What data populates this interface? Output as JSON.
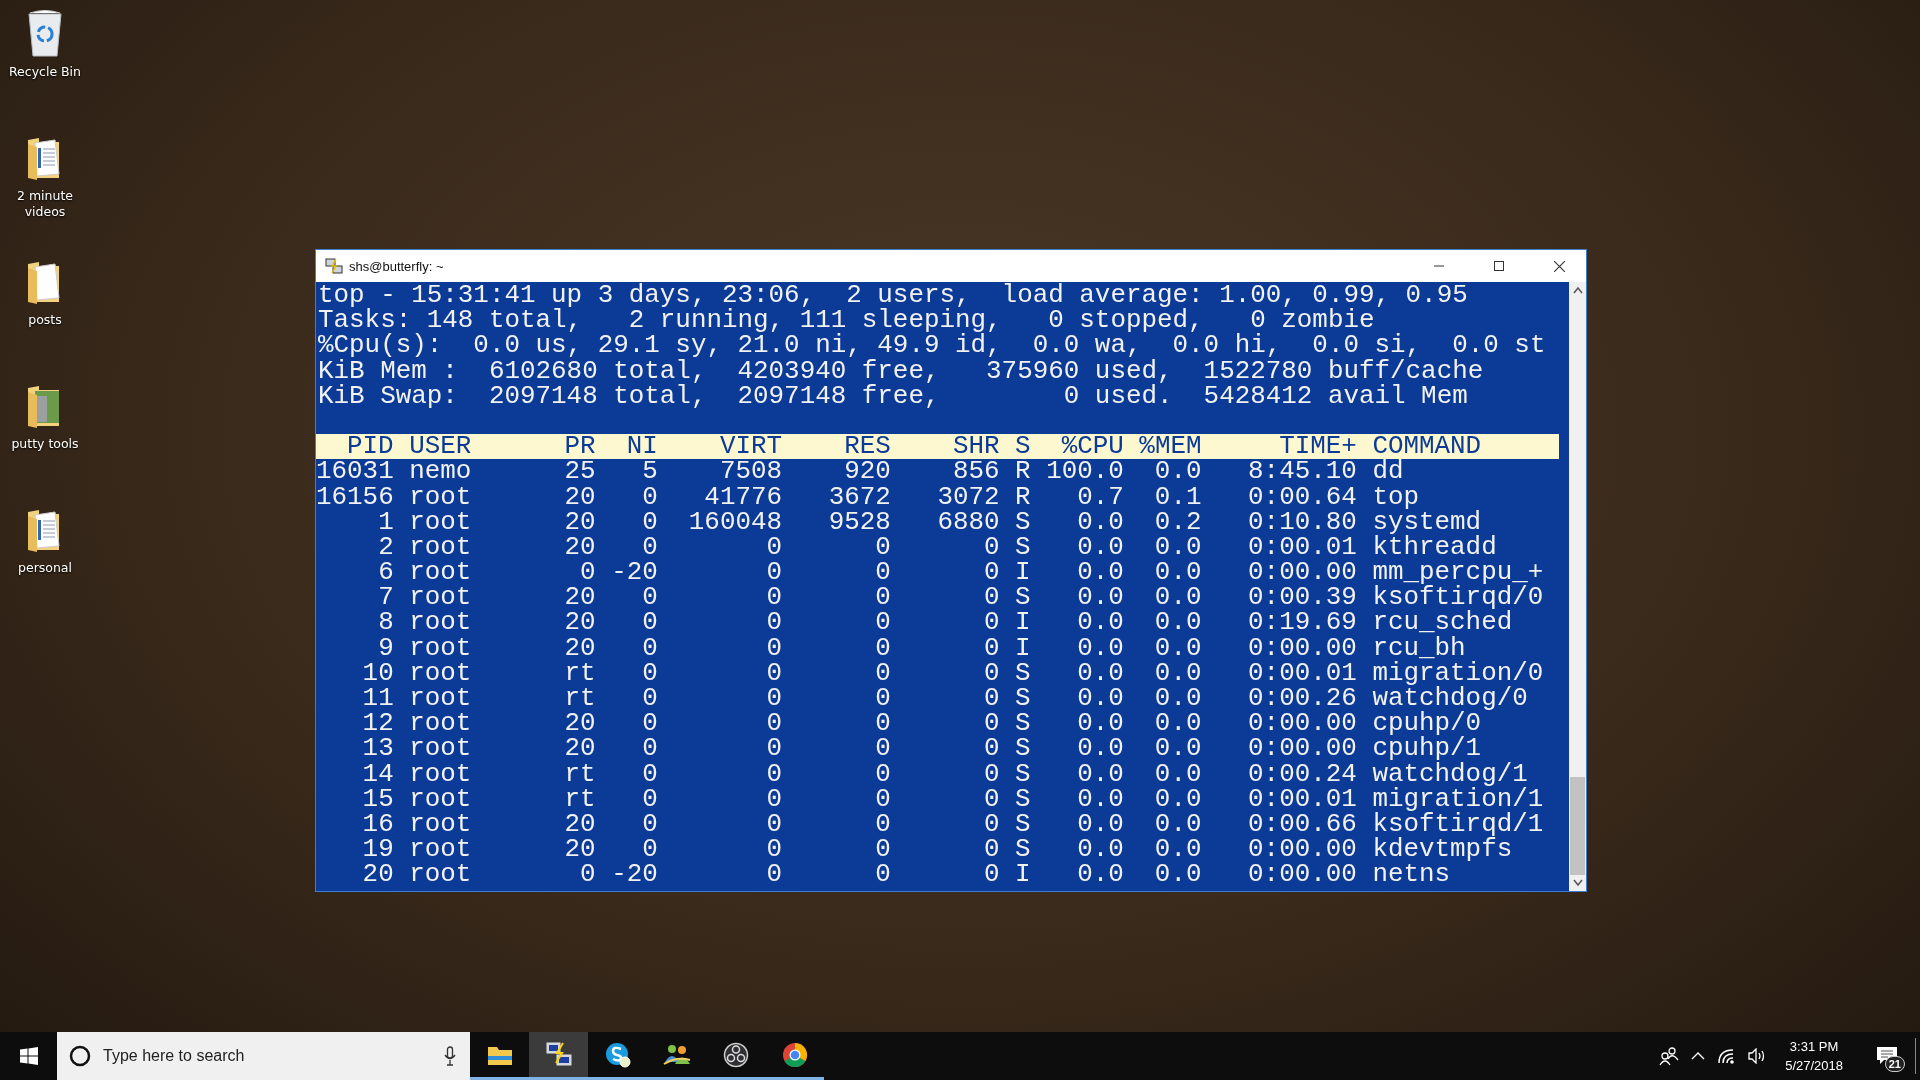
{
  "desktop_icons": [
    {
      "label": "Recycle Bin",
      "kind": "bin"
    },
    {
      "label": "2 minute videos",
      "kind": "documents"
    },
    {
      "label": "posts",
      "kind": "papers"
    },
    {
      "label": "putty tools",
      "kind": "photos"
    },
    {
      "label": "personal",
      "kind": "documents"
    }
  ],
  "terminal": {
    "title": "shs@butterfly: ~",
    "summary_lines": [
      "top - 15:31:41 up 3 days, 23:06,  2 users,  load average: 1.00, 0.99, 0.95",
      "Tasks: 148 total,   2 running, 111 sleeping,   0 stopped,   0 zombie",
      "%Cpu(s):  0.0 us, 29.1 sy, 21.0 ni, 49.9 id,  0.0 wa,  0.0 hi,  0.0 si,  0.0 st",
      "KiB Mem :  6102680 total,  4203940 free,   375960 used,  1522780 buff/cache",
      "KiB Swap:  2097148 total,  2097148 free,        0 used.  5428412 avail Mem"
    ],
    "columns": [
      "PID",
      "USER",
      "PR",
      "NI",
      "VIRT",
      "RES",
      "SHR",
      "S",
      "%CPU",
      "%MEM",
      "TIME+",
      "COMMAND"
    ],
    "rows": [
      [
        "16031",
        "nemo",
        "25",
        "5",
        "7508",
        "920",
        "856",
        "R",
        "100.0",
        "0.0",
        "8:45.10",
        "dd"
      ],
      [
        "16156",
        "root",
        "20",
        "0",
        "41776",
        "3672",
        "3072",
        "R",
        "0.7",
        "0.1",
        "0:00.64",
        "top"
      ],
      [
        "1",
        "root",
        "20",
        "0",
        "160048",
        "9528",
        "6880",
        "S",
        "0.0",
        "0.2",
        "0:10.80",
        "systemd"
      ],
      [
        "2",
        "root",
        "20",
        "0",
        "0",
        "0",
        "0",
        "S",
        "0.0",
        "0.0",
        "0:00.01",
        "kthreadd"
      ],
      [
        "6",
        "root",
        "0",
        "-20",
        "0",
        "0",
        "0",
        "I",
        "0.0",
        "0.0",
        "0:00.00",
        "mm_percpu_+"
      ],
      [
        "7",
        "root",
        "20",
        "0",
        "0",
        "0",
        "0",
        "S",
        "0.0",
        "0.0",
        "0:00.39",
        "ksoftirqd/0"
      ],
      [
        "8",
        "root",
        "20",
        "0",
        "0",
        "0",
        "0",
        "I",
        "0.0",
        "0.0",
        "0:19.69",
        "rcu_sched"
      ],
      [
        "9",
        "root",
        "20",
        "0",
        "0",
        "0",
        "0",
        "I",
        "0.0",
        "0.0",
        "0:00.00",
        "rcu_bh"
      ],
      [
        "10",
        "root",
        "rt",
        "0",
        "0",
        "0",
        "0",
        "S",
        "0.0",
        "0.0",
        "0:00.01",
        "migration/0"
      ],
      [
        "11",
        "root",
        "rt",
        "0",
        "0",
        "0",
        "0",
        "S",
        "0.0",
        "0.0",
        "0:00.26",
        "watchdog/0"
      ],
      [
        "12",
        "root",
        "20",
        "0",
        "0",
        "0",
        "0",
        "S",
        "0.0",
        "0.0",
        "0:00.00",
        "cpuhp/0"
      ],
      [
        "13",
        "root",
        "20",
        "0",
        "0",
        "0",
        "0",
        "S",
        "0.0",
        "0.0",
        "0:00.00",
        "cpuhp/1"
      ],
      [
        "14",
        "root",
        "rt",
        "0",
        "0",
        "0",
        "0",
        "S",
        "0.0",
        "0.0",
        "0:00.24",
        "watchdog/1"
      ],
      [
        "15",
        "root",
        "rt",
        "0",
        "0",
        "0",
        "0",
        "S",
        "0.0",
        "0.0",
        "0:00.01",
        "migration/1"
      ],
      [
        "16",
        "root",
        "20",
        "0",
        "0",
        "0",
        "0",
        "S",
        "0.0",
        "0.0",
        "0:00.66",
        "ksoftirqd/1"
      ],
      [
        "19",
        "root",
        "20",
        "0",
        "0",
        "0",
        "0",
        "S",
        "0.0",
        "0.0",
        "0:00.00",
        "kdevtmpfs"
      ],
      [
        "20",
        "root",
        "0",
        "-20",
        "0",
        "0",
        "0",
        "I",
        "0.0",
        "0.0",
        "0:00.00",
        "netns"
      ]
    ]
  },
  "taskbar": {
    "search": {
      "placeholder": "Type here to search"
    },
    "apps": [
      {
        "kind": "explorer",
        "selected": false
      },
      {
        "kind": "putty",
        "selected": true
      },
      {
        "kind": "chat",
        "selected": false
      },
      {
        "kind": "people",
        "selected": false
      },
      {
        "kind": "recorder",
        "selected": false
      },
      {
        "kind": "browser",
        "selected": false
      }
    ],
    "clock": {
      "time": "3:31 PM",
      "date": "5/27/2018"
    },
    "notifications": {
      "count": "21"
    }
  }
}
